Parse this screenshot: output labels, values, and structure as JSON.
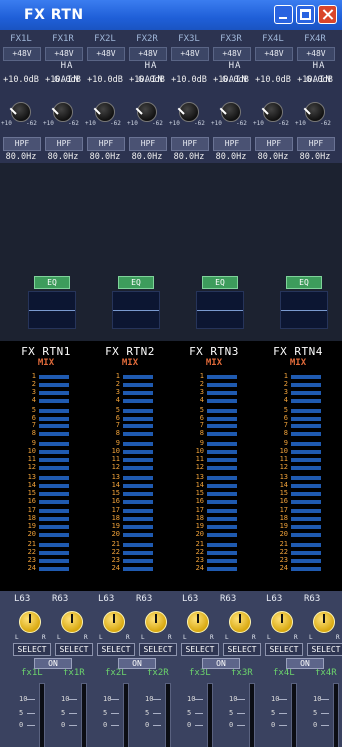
{
  "window": {
    "title": "FX RTN"
  },
  "top": {
    "channels": [
      "FX1L",
      "FX1R",
      "FX2L",
      "FX2R",
      "FX3L",
      "FX3R",
      "FX4L",
      "FX4R"
    ],
    "phantom": "+48V",
    "ha_gain_label": "HA GAIN",
    "gain_values": [
      "+10.0dB",
      "+10.0dB",
      "+10.0dB",
      "+10.0dB",
      "+10.0dB",
      "+10.0dB",
      "+10.0dB",
      "+10.0dB"
    ],
    "knob_min": "+10",
    "knob_max": "-62",
    "hpf_label": "HPF",
    "hpf_freq": "80.0Hz",
    "phase_symbol": "ø"
  },
  "eq": {
    "label": "EQ"
  },
  "returns": [
    {
      "name": "FX RTN1",
      "mix": "MIX"
    },
    {
      "name": "FX RTN2",
      "mix": "MIX"
    },
    {
      "name": "FX RTN3",
      "mix": "MIX"
    },
    {
      "name": "FX RTN4",
      "mix": "MIX"
    }
  ],
  "mix_buses": [
    "1",
    "2",
    "3",
    "4",
    "5",
    "6",
    "7",
    "8",
    "9",
    "10",
    "11",
    "12",
    "13",
    "14",
    "15",
    "16",
    "17",
    "18",
    "19",
    "20",
    "21",
    "22",
    "23",
    "24"
  ],
  "bottom": {
    "pan": [
      {
        "l": "L63",
        "r": "R63"
      },
      {
        "l": "L63",
        "r": "R63"
      },
      {
        "l": "L63",
        "r": "R63"
      },
      {
        "l": "L63",
        "r": "R63"
      }
    ],
    "select_label": "SELECT",
    "on_label": "ON",
    "pan_left": "L",
    "pan_right": "R",
    "fx_names": [
      "fx1L",
      "fx1R",
      "fx2L",
      "fx2R",
      "fx3L",
      "fx3R",
      "fx4L",
      "fx4R"
    ],
    "fader_scale": [
      "10",
      "5",
      "0"
    ]
  },
  "colors": {
    "accent_title": "#1f5fd8",
    "eq_green": "#3d9c5c",
    "bus_orange": "#f0a23a",
    "fx_green": "#6cd46c",
    "pan_knob": "#e0b020"
  }
}
